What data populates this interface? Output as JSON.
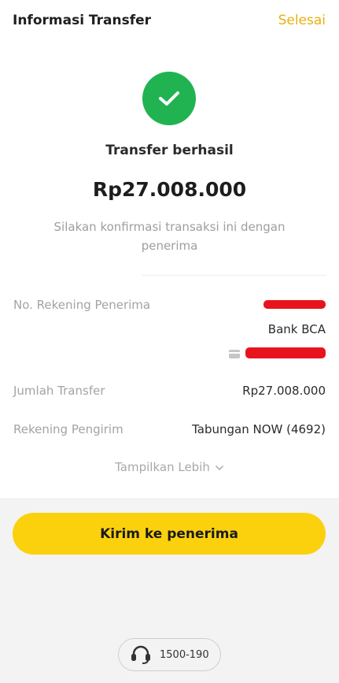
{
  "header": {
    "title": "Informasi Transfer",
    "done_label": "Selesai"
  },
  "result": {
    "status": "Transfer berhasil",
    "amount": "Rp27.008.000",
    "subtitle": "Silakan konfirmasi transaksi ini dengan penerima"
  },
  "details": {
    "recipient_label": "No. Rekening Penerima",
    "recipient_bank": "Bank BCA",
    "amount_label": "Jumlah Transfer",
    "amount_value": "Rp27.008.000",
    "source_label": "Rekening Pengirim",
    "source_value": "Tabungan NOW (4692)",
    "show_more_label": "Tampilkan Lebih"
  },
  "actions": {
    "send_to_recipient": "Kirim ke penerima"
  },
  "help": {
    "phone": "1500-190"
  },
  "colors": {
    "accent": "#fbd10e",
    "link": "#e8b10b",
    "success": "#21b352",
    "redaction": "#e8141d"
  },
  "icons": [
    "check-icon",
    "card-icon",
    "chevron-down-icon",
    "headset-icon"
  ]
}
